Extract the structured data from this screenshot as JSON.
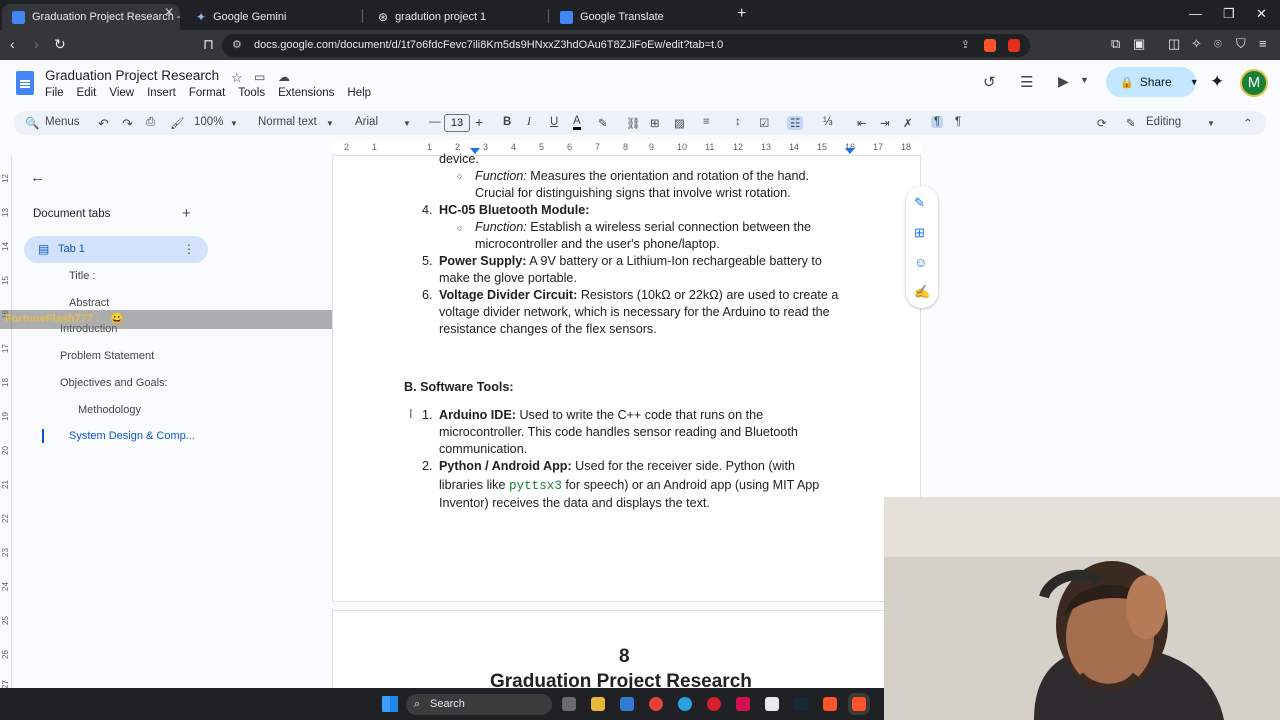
{
  "browser": {
    "tabs": [
      {
        "title": "Graduation Project Research - Goog",
        "active": true
      },
      {
        "title": "Google Gemini"
      },
      {
        "title": "gradution project 1"
      },
      {
        "title": "Google Translate"
      }
    ],
    "url": "docs.google.com/document/d/1t7o6fdcFevc7ili8Km5ds9HNxxZ3hdOAu6T8ZJiFoEw/edit?tab=t.0"
  },
  "docs": {
    "title": "Graduation Project Research",
    "menus": [
      "File",
      "Edit",
      "View",
      "Insert",
      "Format",
      "Tools",
      "Extensions",
      "Help"
    ],
    "share_label": "Share",
    "avatar_letter": "M",
    "toolbar": {
      "menus_label": "Menus",
      "zoom": "100%",
      "style": "Normal text",
      "font": "Arial",
      "font_size": "13",
      "mode": "Editing"
    }
  },
  "ruler": {
    "marks": [
      "2",
      "1",
      "1",
      "2",
      "3",
      "4",
      "5",
      "6",
      "7",
      "8",
      "9",
      "10",
      "11",
      "12",
      "13",
      "14",
      "15",
      "16",
      "17",
      "18"
    ]
  },
  "vertical_ruler": [
    "12",
    "13",
    "14",
    "15",
    "16",
    "17",
    "18",
    "19",
    "20",
    "21",
    "22",
    "23",
    "24",
    "25",
    "26",
    "27"
  ],
  "sidebar": {
    "heading": "Document tabs",
    "tab_name": "Tab 1",
    "outline": [
      "Title :",
      "Abstract",
      "Introduction",
      "Problem Statement",
      "Objectives and Goals:",
      "Methodology",
      "System Design & Comp..."
    ]
  },
  "overlay": {
    "chat_name": "FortuneFlash777 :",
    "chat_emoji": "😀"
  },
  "document": {
    "lines": {
      "l0": "device.",
      "l1_em": "Function:",
      "l1": " Measures the orientation and rotation of the hand.",
      "l2": "Crucial for distinguishing signs that involve wrist rotation.",
      "l3_num": "4.",
      "l3_b": "HC-05 Bluetooth Module:",
      "l4_em": "Function:",
      "l4": " Establish a wireless serial connection between the",
      "l5": "microcontroller and the user's phone/laptop.",
      "l6_num": "5.",
      "l6_b": "Power Supply:",
      "l6": " A 9V battery or a Lithium-Ion rechargeable battery to",
      "l7": "make the glove portable.",
      "l8_num": "6.",
      "l8_b": "Voltage Divider Circuit:",
      "l8": " Resistors (10kΩ or 22kΩ) are used to create a",
      "l9": "voltage divider network, which is necessary for the Arduino to read the",
      "l10": "resistance changes of the flex sensors.",
      "heading": "B. Software Tools:",
      "s1_num": "1.",
      "s1_b": "Arduino IDE:",
      "s1": " Used to write the C++ code that runs on the",
      "s2": "microcontroller. This code handles sensor reading and Bluetooth",
      "s3": "communication.",
      "s4_num": "2.",
      "s4_b": "Python / Android App:",
      "s4": " Used for the receiver side. Python (with",
      "s5a": "libraries like ",
      "s5_code": "pyttsx3",
      "s5b": " for speech) or an Android app (using MIT App",
      "s6": "Inventor) receives the data and displays the text."
    },
    "page_number": "8",
    "page2_title": "Graduation Project Research"
  },
  "taskbar": {
    "search_label": "Search"
  }
}
